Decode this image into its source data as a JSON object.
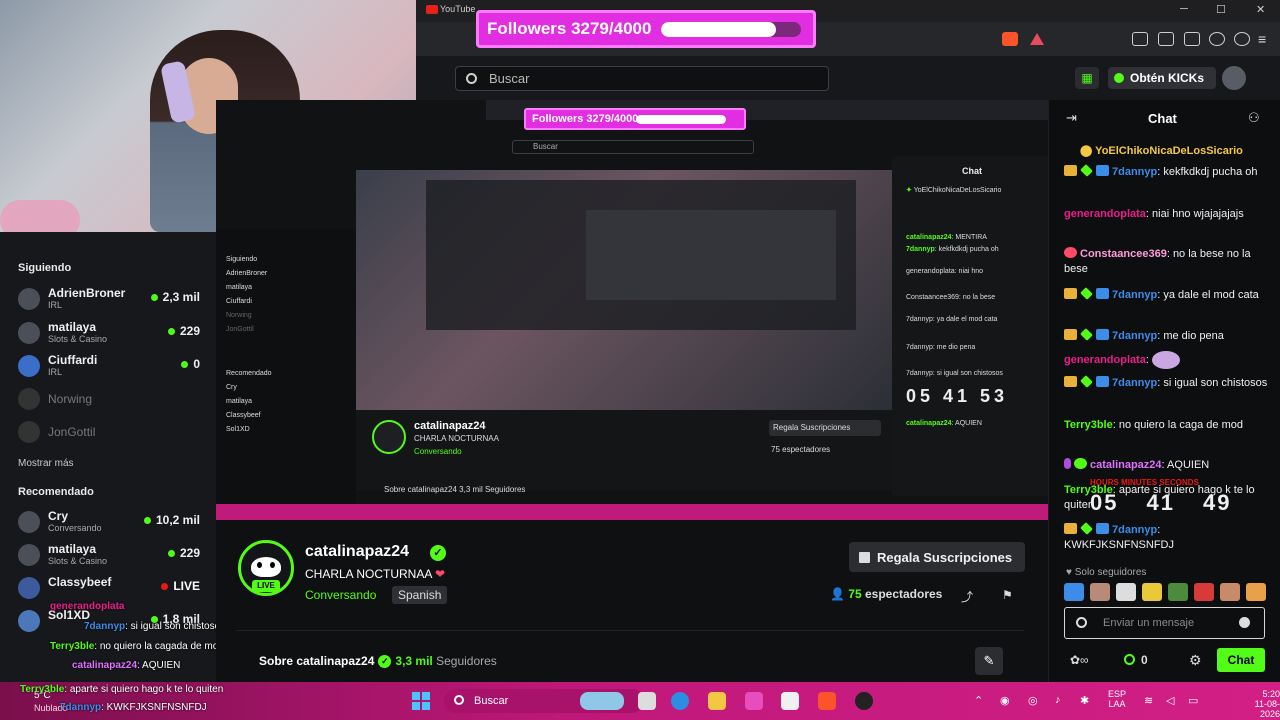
{
  "browser": {
    "tab_title": "YouTube",
    "window_controls": [
      "─",
      "☐",
      "✕"
    ]
  },
  "goal": {
    "label": "Followers 3279/4000",
    "current": 3279,
    "target": 4000
  },
  "header": {
    "search_placeholder": "Buscar",
    "kicks_button": "Obtén KICKs"
  },
  "sidebar": {
    "following_heading": "Siguiendo",
    "following": [
      {
        "name": "AdrienBroner",
        "category": "IRL",
        "viewers": "2,3 mil",
        "live": true
      },
      {
        "name": "matilaya",
        "category": "Slots & Casino",
        "viewers": "229",
        "live": true
      },
      {
        "name": "Ciuffardi",
        "category": "IRL",
        "viewers": "0",
        "live": true
      },
      {
        "name": "Norwing",
        "category": "",
        "viewers": "",
        "live": false
      },
      {
        "name": "JonGottil",
        "category": "",
        "viewers": "",
        "live": false
      }
    ],
    "show_more": "Mostrar más",
    "recommended_heading": "Recomendado",
    "recommended": [
      {
        "name": "Cry",
        "category": "Conversando",
        "viewers": "10,2 mil"
      },
      {
        "name": "matilaya",
        "category": "Slots & Casino",
        "viewers": "229"
      },
      {
        "name": "Classybeef",
        "category": "",
        "viewers": "LIVE"
      },
      {
        "name": "Sol1XD",
        "category": "",
        "viewers": "1,8 mil"
      }
    ]
  },
  "overlay_chat": [
    {
      "user": "generandoplata",
      "text": ""
    },
    {
      "user": "7dannyp",
      "text": ": si igual son chistosos"
    },
    {
      "user": "Terry3ble",
      "text": ": no quiero la cagada de mod"
    },
    {
      "user": "catalinapaz24",
      "text": ": AQUIEN"
    },
    {
      "user": "Terry3ble",
      "text": ": aparte si quiero hago k te lo quiten"
    },
    {
      "user": "7dannyp",
      "text": ": KWKFJKSNFNSNFDJ"
    }
  ],
  "channel": {
    "name": "catalinapaz24",
    "live_badge": "LIVE",
    "title": "CHARLA NOCTURNAA",
    "title_heart": "❤",
    "category": "Conversando",
    "language": "Spanish",
    "gift_button": "Regala Suscripciones",
    "viewers": "75",
    "viewers_label": "espectadores",
    "about_prefix": "Sobre catalinapaz24",
    "followers": "3,3 mil",
    "followers_label": "Seguidores"
  },
  "chat": {
    "title": "Chat",
    "pinned_user": "YoElChikoNicaDeLosSicario",
    "messages": [
      {
        "user": "7dannyp",
        "color": "#3c8ce8",
        "badges": [
          "crown",
          "diamond",
          "x"
        ],
        "text": ": kekfkdkdj pucha oh"
      },
      {
        "user": "generandoplata",
        "color": "#e91e8c",
        "badges": [],
        "text": ": niai hno wjajajajajs"
      },
      {
        "user": "Constaancee369",
        "color": "#ff9bd8",
        "badges": [
          "heart"
        ],
        "text": ": no la bese no la bese"
      },
      {
        "user": "7dannyp",
        "color": "#3c8ce8",
        "badges": [
          "crown",
          "diamond",
          "x"
        ],
        "text": ": ya dale el mod cata"
      },
      {
        "user": "7dannyp",
        "color": "#3c8ce8",
        "badges": [
          "crown",
          "diamond",
          "x"
        ],
        "text": ": me dio pena"
      },
      {
        "user": "generandoplata",
        "color": "#e91e8c",
        "badges": [],
        "text": ":"
      },
      {
        "user": "7dannyp",
        "color": "#3c8ce8",
        "badges": [
          "crown",
          "diamond",
          "x"
        ],
        "text": ": si igual son chistosos"
      },
      {
        "user": "Terry3ble",
        "color": "#53fc18",
        "badges": [],
        "text": ": no quiero la caga de mod"
      },
      {
        "user": "catalinapaz24",
        "color": "#e070ff",
        "badges": [
          "mic",
          "verified"
        ],
        "text": ": AQUIEN"
      },
      {
        "user": "Terry3ble",
        "color": "#53fc18",
        "badges": [],
        "text": ": aparte si quiero hago k te lo quiten"
      },
      {
        "user": "7dannyp",
        "color": "#3c8ce8",
        "badges": [
          "crown",
          "diamond",
          "x"
        ],
        "text": ": KWKFJKSNFNSNFDJ"
      }
    ],
    "timer": [
      "05",
      "41",
      "49"
    ],
    "timer_labels": "HOURS   MINUTES   SECONDS",
    "followers_only": "Solo seguidores",
    "input_placeholder": "Enviar un mensaje",
    "kicks": "0",
    "send_button": "Chat"
  },
  "taskbar": {
    "weather": "5°C",
    "weather_sub": "Nublado",
    "search": "Buscar",
    "lang": "ESP",
    "lang_sub": "LAA",
    "time": "5:20",
    "date": "11-08-2026"
  },
  "nested": {
    "goal": "Followers 3279/4000",
    "search": "Buscar",
    "chat_title": "Chat",
    "name": "catalinapaz24",
    "sub": "CHARLA NOCTURNAA",
    "category": "Conversando",
    "gift": "Regala Suscripciones",
    "viewers": "75 espectadores",
    "about": "Sobre catalinapaz24  3,3 mil Seguidores",
    "timer": "05 41 53"
  }
}
